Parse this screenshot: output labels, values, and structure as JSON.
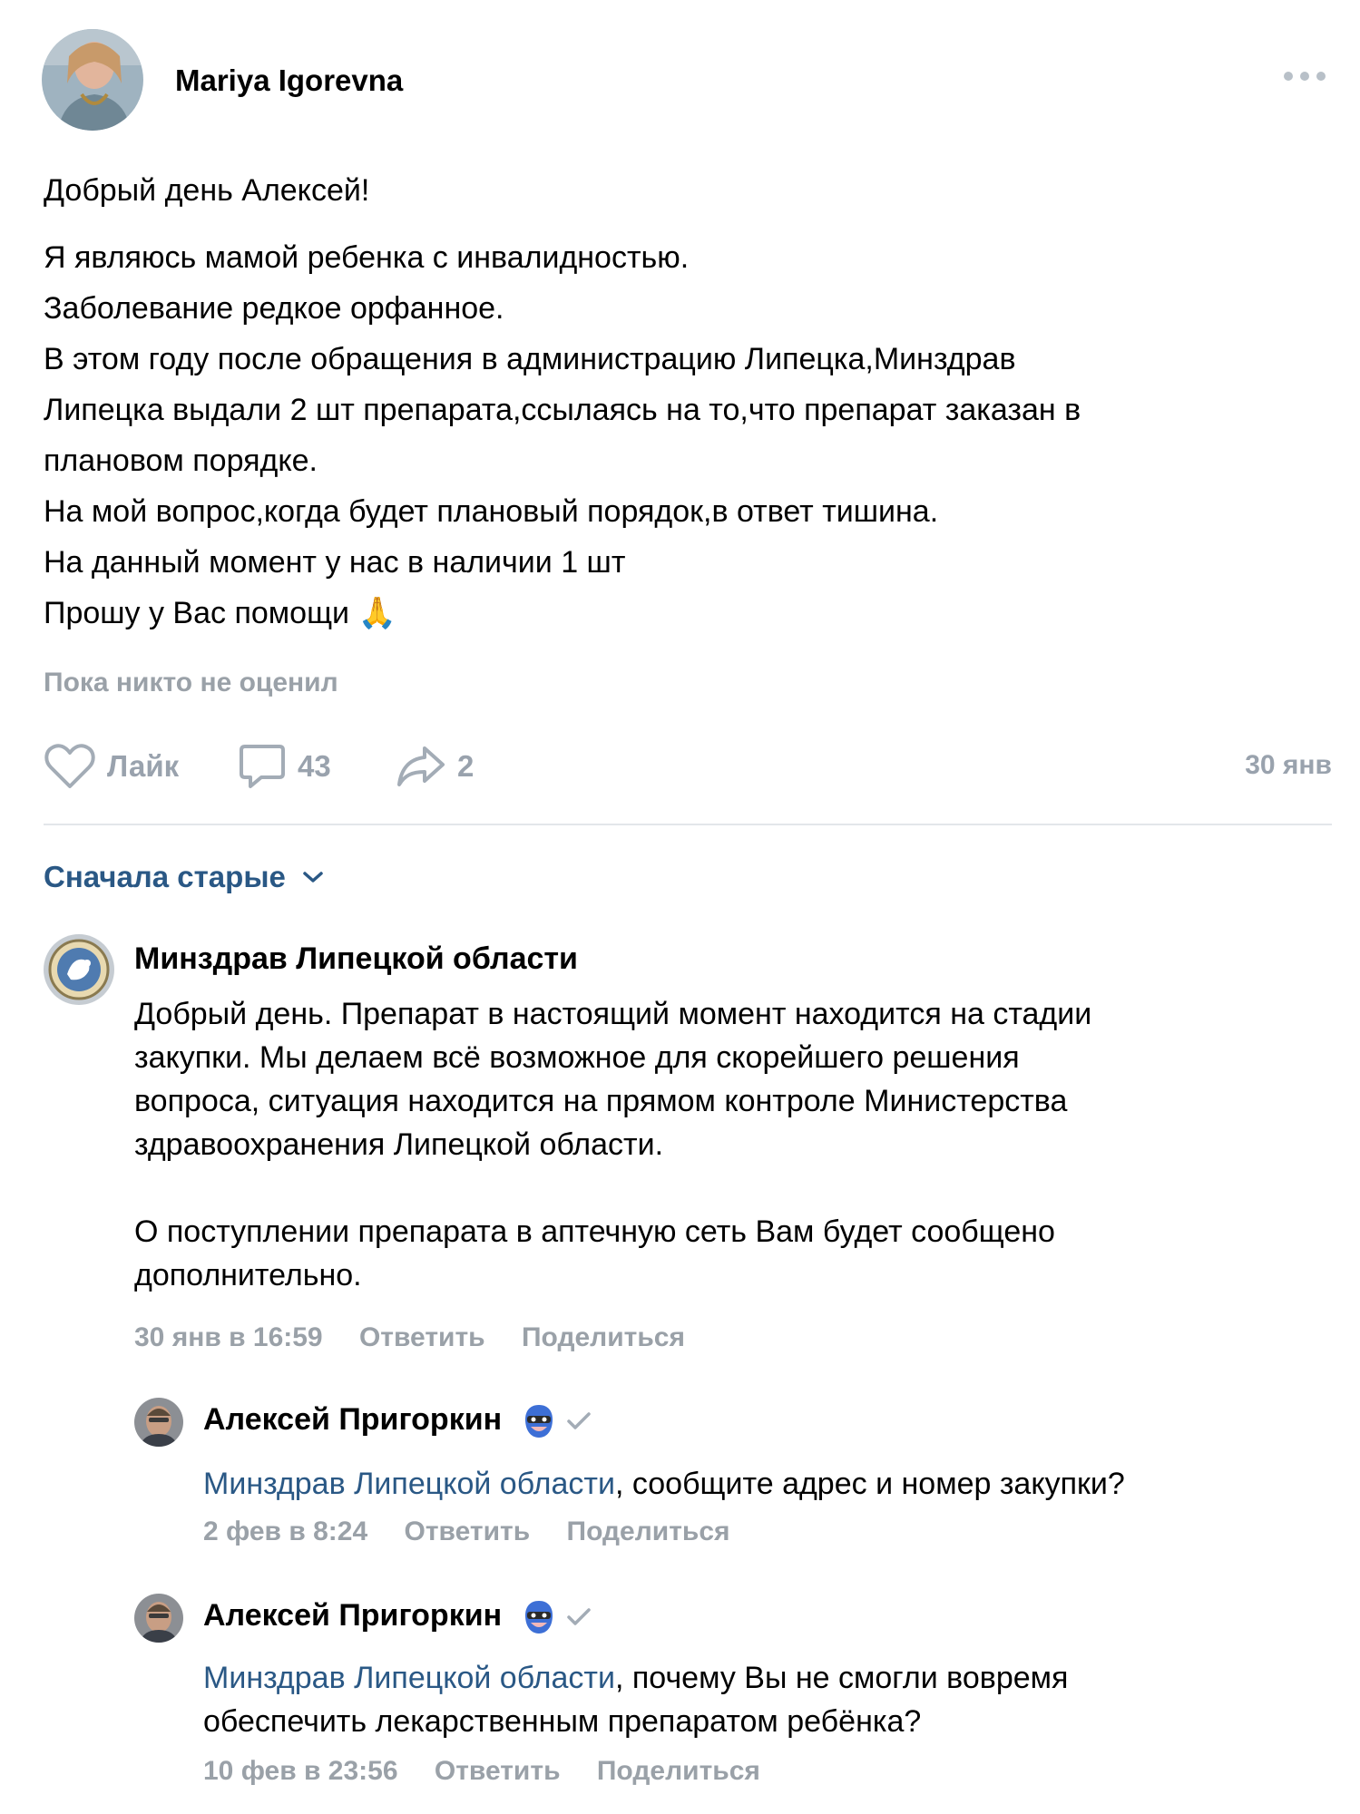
{
  "post": {
    "author": "Mariya Igorevna",
    "greeting": "Добрый день Алексей!",
    "lines": [
      "Я являюсь мамой ребенка с инвалидностью.",
      "Заболевание редкое орфанное.",
      "В этом году после обращения в администрацию Липецка,Минздрав",
      "Липецка выдали 2 шт препарата,ссылаясь на то,что препарат заказан в",
      "плановом порядке.",
      "На мой вопрос,когда будет плановый порядок,в ответ тишина.",
      "На данный момент у нас в наличии 1 шт",
      "Прошу у Вас помощи 🙏"
    ],
    "likes_note": "Пока никто не оценил",
    "like_label": "Лайк",
    "comments_count": "43",
    "shares_count": "2",
    "date": "30 янв"
  },
  "sort_label": "Сначала старые",
  "comments": [
    {
      "author": "Минздрав Липецкой области",
      "text_lines": [
        "Добрый день. Препарат в настоящий момент находится на стадии",
        "закупки. Мы делаем всё возможное для скорейшего решения",
        "вопроса, ситуация находится на прямом контроле Министерства",
        "здравоохранения Липецкой области."
      ],
      "text_lines2": [
        "О поступлении препарата в аптечную сеть Вам будет сообщено",
        "дополнительно."
      ],
      "time": "30 янв в 16:59",
      "reply": "Ответить",
      "share": "Поделиться"
    },
    {
      "author": "Алексей Пригоркин",
      "mention": "Минздрав Липецкой области",
      "text_lines": [
        ", сообщите адрес и номер закупки?"
      ],
      "time": "2 фев в 8:24",
      "reply": "Ответить",
      "share": "Поделиться"
    },
    {
      "author": "Алексей Пригоркин",
      "mention": "Минздрав Липецкой области",
      "text_lines": [
        ", почему Вы не смогли вовремя",
        "обеспечить лекарственным препаратом ребёнка?"
      ],
      "time": "10 фев в 23:56",
      "reply": "Ответить",
      "share": "Поделиться"
    }
  ],
  "colors": {
    "link": "#2a5885",
    "muted": "#99a2ad",
    "divider": "#e3e6ea"
  },
  "icons": [
    "more-icon",
    "heart-icon",
    "comment-icon",
    "share-icon",
    "chevron-down-icon",
    "superhero-badge-icon",
    "verified-check-icon"
  ]
}
